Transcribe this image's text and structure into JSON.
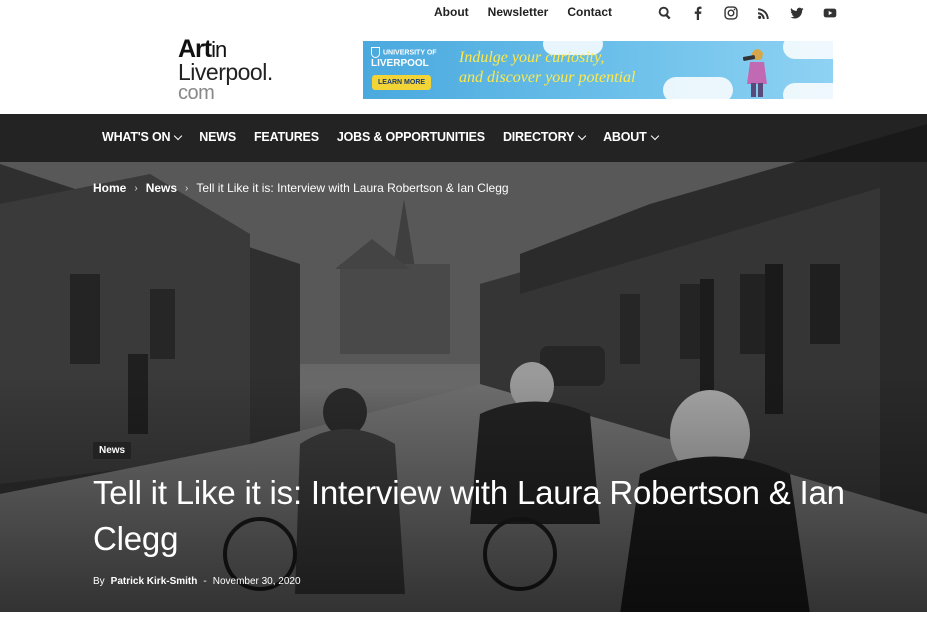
{
  "top_links": [
    "About",
    "Newsletter",
    "Contact"
  ],
  "social_icons": [
    "search-icon",
    "facebook-icon",
    "instagram-icon",
    "rss-icon",
    "twitter-icon",
    "youtube-icon"
  ],
  "logo": {
    "line1_bold": "Art",
    "line1_rest": "in",
    "line2": "Liverpool.",
    "line3": "com"
  },
  "banner": {
    "university": "UNIVERSITY OF",
    "university_name": "LIVERPOOL",
    "learn_more": "LEARN MORE",
    "tagline_1": "Indulge your curiosity,",
    "tagline_2": "and discover your potential"
  },
  "nav": {
    "items": [
      {
        "label": "WHAT'S ON"
      },
      {
        "label": "NEWS"
      },
      {
        "label": "FEATURES"
      },
      {
        "label": "JOBS & OPPORTUNITIES"
      },
      {
        "label": "DIRECTORY"
      },
      {
        "label": "ABOUT"
      }
    ]
  },
  "breadcrumb": {
    "home": "Home",
    "section": "News",
    "current": "Tell it Like it is: Interview with Laura Robertson & Ian Clegg",
    "sep": "›"
  },
  "article": {
    "category": "News",
    "title": "Tell it Like it is: Interview with Laura Robertson & Ian Clegg",
    "by": "By",
    "author": "Patrick Kirk-Smith",
    "dash": "-",
    "date": "November 30, 2020"
  },
  "colors": {
    "nav_bg": "#141414",
    "banner_blue": "#4aa9de",
    "banner_text": "#ffe94a",
    "learn_more": "#f3d436"
  }
}
